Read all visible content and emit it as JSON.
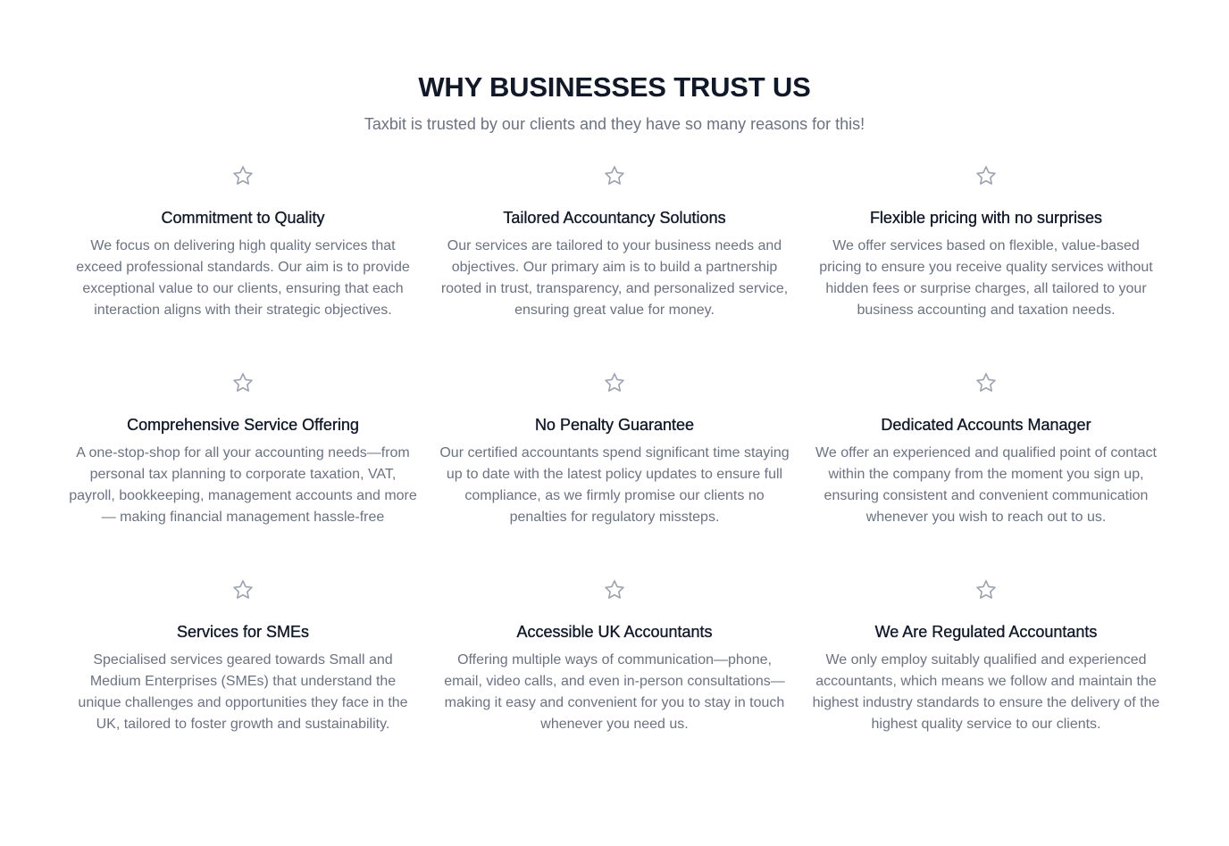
{
  "header": {
    "title": "WHY BUSINESSES TRUST US",
    "subtitle": "Taxbit is trusted by our clients and they have so many reasons for this!"
  },
  "colors": {
    "heading": "#111827",
    "body_text": "#6b7280",
    "icon": "#9ca3af"
  },
  "features": [
    {
      "icon": "star-icon",
      "title": "Commitment to Quality",
      "description": "We focus on delivering high quality services that exceed professional standards. Our aim is to provide exceptional value to our clients, ensuring that each interaction aligns with their strategic objectives."
    },
    {
      "icon": "star-icon",
      "title": "Tailored Accountancy Solutions",
      "description": "Our services are tailored to your business needs and objectives. Our primary aim is to build a partnership rooted in trust, transparency, and personalized service, ensuring great value for money."
    },
    {
      "icon": "star-icon",
      "title": "Flexible pricing with no surprises",
      "description": "We offer services based on flexible, value-based pricing to ensure you receive quality services without hidden fees or surprise charges, all tailored to your business accounting and taxation needs."
    },
    {
      "icon": "star-icon",
      "title": "Comprehensive Service Offering",
      "description": "A one-stop-shop for all your accounting needs—from personal tax planning to corporate taxation, VAT, payroll, bookkeeping, management accounts and more— making financial management hassle-free"
    },
    {
      "icon": "star-icon",
      "title": "No Penalty Guarantee",
      "description": "Our certified accountants spend significant time staying up to date with the latest policy updates to ensure full compliance, as we firmly promise our clients no penalties for regulatory missteps."
    },
    {
      "icon": "star-icon",
      "title": "Dedicated Accounts Manager",
      "description": "We offer an experienced and qualified point of contact within the company from the moment you sign up, ensuring consistent and convenient communication whenever you wish to reach out to us."
    },
    {
      "icon": "star-icon",
      "title": "Services for SMEs",
      "description": "Specialised services geared towards Small and Medium Enterprises (SMEs) that understand the unique challenges and opportunities they face in the UK, tailored to foster growth and sustainability."
    },
    {
      "icon": "star-icon",
      "title": "Accessible UK Accountants",
      "description": "Offering multiple ways of communication—phone, email, video calls, and even in-person consultations—making it easy and convenient for you to stay in touch whenever you need us."
    },
    {
      "icon": "star-icon",
      "title": "We Are Regulated Accountants",
      "description": "We only employ suitably qualified and experienced accountants, which means we follow and maintain the highest industry standards to ensure the delivery of the highest quality service to our clients."
    }
  ]
}
